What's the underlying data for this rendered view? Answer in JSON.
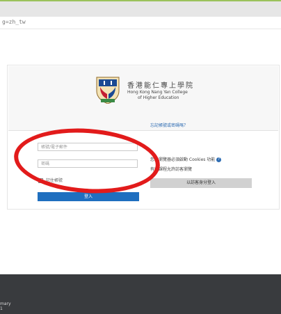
{
  "browser": {
    "url_fragment": "g=zh_tw"
  },
  "logo": {
    "name_zh": "香港能仁專上學院",
    "name_en_line1": "Hong Kong Nang Yan College",
    "name_en_line2": "of Higher Education"
  },
  "form": {
    "username_placeholder": "帳號/電子郵件",
    "password_placeholder": "密碼",
    "remember_label": "記住帳號",
    "login_button": "登入"
  },
  "side": {
    "forgot_link": "忘記帳號或密碼嗎？",
    "cookie_notice": "您的瀏覽器必須啟動 Cookies 功能",
    "guest_notice": "有些課程允許訪客瀏覽",
    "guest_button": "以訪客身分登入",
    "help_icon": "?"
  },
  "footer": {
    "line1": "mary",
    "line2": "1"
  },
  "colors": {
    "login_button": "#1f6fbf",
    "footer_bg": "#393b3e",
    "annotation": "#e21b1b"
  }
}
